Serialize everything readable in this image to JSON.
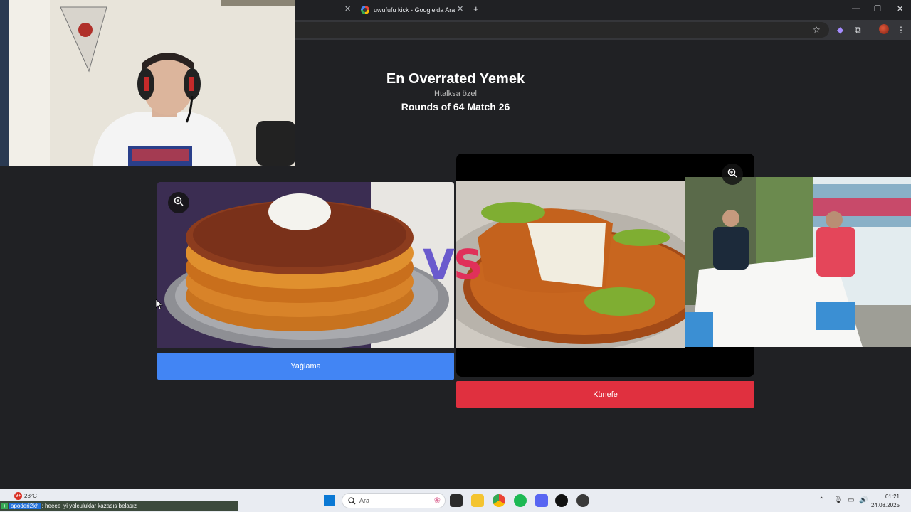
{
  "browser": {
    "tabs": [
      {
        "label": ""
      },
      {
        "label": "uwufufu kick - Google'da Ara"
      }
    ]
  },
  "page": {
    "title": "En Overrated Yemek",
    "subtitle": "Htalksa özel",
    "round": "Rounds of 64 Match 26",
    "vs_v": "V",
    "vs_s": "S",
    "left_choice": "Yağlama",
    "right_choice": "Künefe"
  },
  "taskbar": {
    "weather_badge": "9+",
    "temperature": "23°C",
    "search_placeholder": "Ara",
    "time": "01:21",
    "date": "24.08.2025"
  },
  "chat": {
    "user": "apoderi2kh",
    "message": ": heeee iyi yolculuklar kazasıs belasız"
  },
  "colors": {
    "left_button": "#4285f4",
    "right_button": "#e0303f",
    "page_bg": "#202124"
  }
}
